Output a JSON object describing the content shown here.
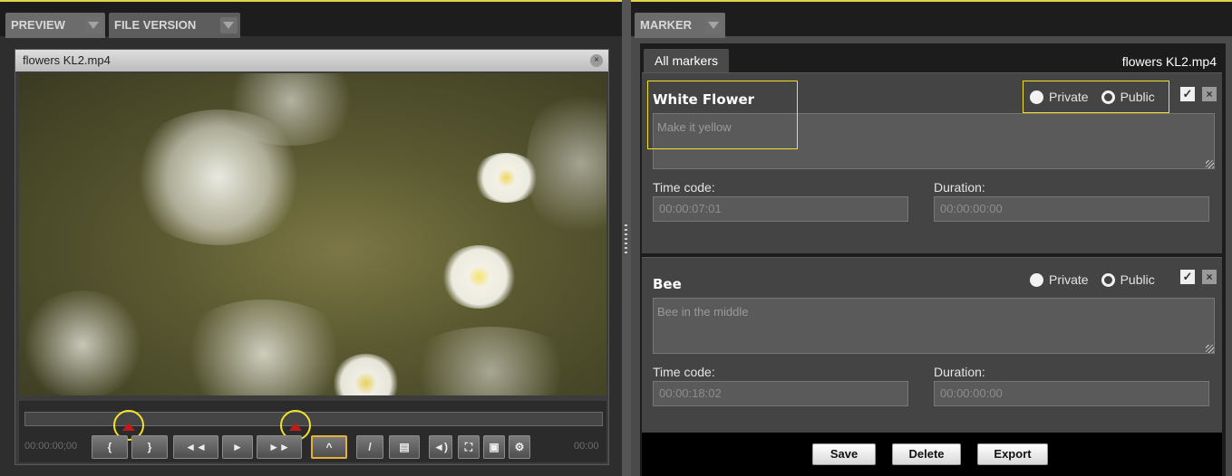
{
  "left_tabs": [
    {
      "label": "PREVIEW"
    },
    {
      "label": "FILE VERSION"
    }
  ],
  "preview": {
    "file_name": "flowers KL2.mp4",
    "time_start": "00:00:00;00",
    "time_end": "00:00",
    "buttons": {
      "mark_in": "{",
      "mark_out": "}",
      "rewind": "◄◄",
      "play": "►",
      "fast_forward": "►►",
      "add_marker": "^",
      "draw": "/",
      "volume": "◄)",
      "fullscreen": "⛶",
      "snapshot": "▣",
      "settings": "⚙"
    }
  },
  "right_tabs": [
    {
      "label": "MARKER"
    }
  ],
  "marker_panel": {
    "subtab": "All markers",
    "file_name": "flowers KL2.mp4",
    "markers": [
      {
        "title": "White Flower",
        "private_label": "Private",
        "public_label": "Public",
        "description": "Make it yellow",
        "time_code_label": "Time code:",
        "time_code": "00:00:07:01",
        "duration_label": "Duration:",
        "duration": "00:00:00:00"
      },
      {
        "title": "Bee",
        "private_label": "Private",
        "public_label": "Public",
        "description": "Bee in the middle",
        "time_code_label": "Time code:",
        "time_code": "00:00:18:02",
        "duration_label": "Duration:",
        "duration": "00:00:00:00"
      }
    ],
    "footer": {
      "save": "Save",
      "delete": "Delete",
      "export": "Export"
    }
  },
  "colors": {
    "accent_yellow": "#f4e12a",
    "marker_red": "#c01a1a",
    "highlight_orange": "#e4b13a"
  }
}
